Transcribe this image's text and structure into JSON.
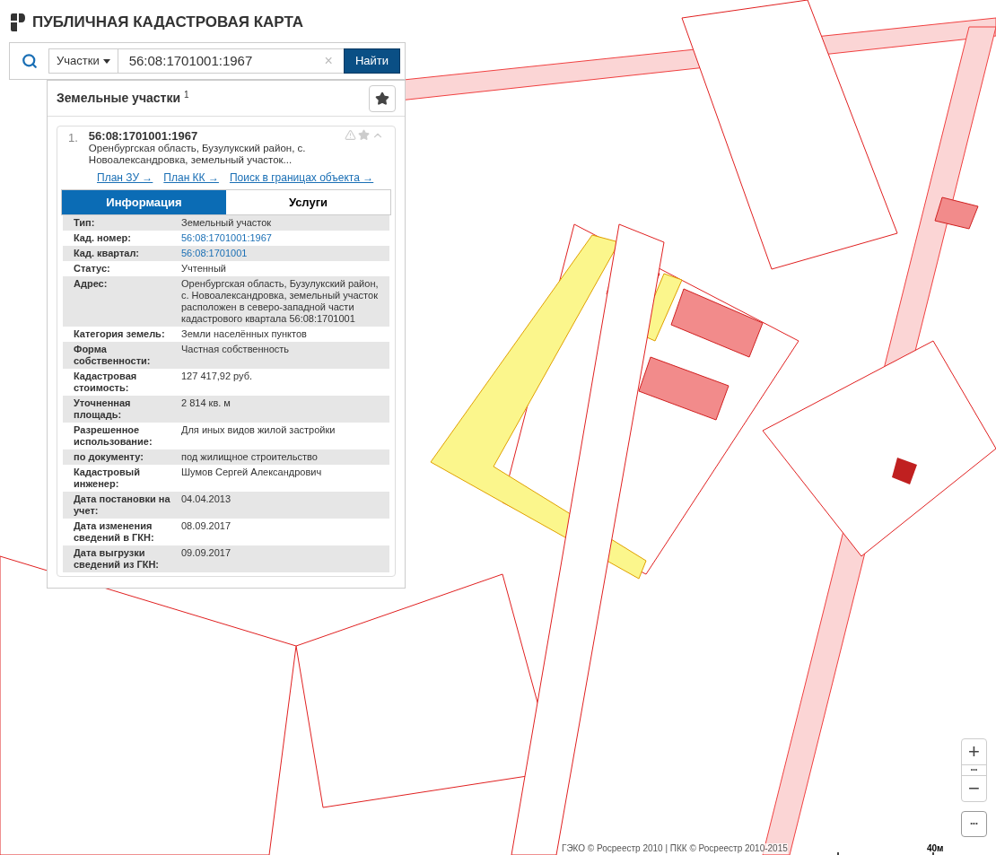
{
  "header": {
    "title": "ПУБЛИЧНАЯ КАДАСТРОВАЯ КАРТА"
  },
  "search": {
    "category": "Участки",
    "value": "56:08:1701001:1967",
    "clear": "×",
    "button": "Найти"
  },
  "panel": {
    "title": "Земельные участки",
    "count": "1",
    "result": {
      "index": "1.",
      "number": "56:08:1701001:1967",
      "address": "Оренбургская область, Бузулукский район, с. Новоалександровка, земельный участок...",
      "expanded": true,
      "links": [
        "План ЗУ →",
        "План КК →",
        "Поиск в границах объекта →"
      ],
      "tabs": [
        {
          "label": "Информация",
          "selected": true
        },
        {
          "label": "Услуги",
          "selected": false
        }
      ],
      "rows": [
        {
          "label": "Тип:",
          "value": "Земельный участок",
          "link": false
        },
        {
          "label": "Кад. номер:",
          "value": "56:08:1701001:1967",
          "link": true
        },
        {
          "label": "Кад. квартал:",
          "value": "56:08:1701001",
          "link": true
        },
        {
          "label": "Статус:",
          "value": "Учтенный",
          "link": false
        },
        {
          "label": "Адрес:",
          "value": "Оренбургская область, Бузулукский район, с. Новоалександровка, земельный участок расположен в северо-западной части кадастрового квартала 56:08:1701001",
          "link": false
        },
        {
          "label": "Категория земель:",
          "value": "Земли населённых пунктов",
          "link": false
        },
        {
          "label": "Форма собственности:",
          "value": "Частная собственность",
          "link": false
        },
        {
          "label": "Кадастровая стоимость:",
          "value": "127 417,92 руб.",
          "link": false
        },
        {
          "label": "Уточненная площадь:",
          "value": "2 814 кв. м",
          "link": false
        },
        {
          "label": "Разрешенное использование:",
          "value": "Для иных видов жилой застройки",
          "link": false
        },
        {
          "label": "по документу:",
          "value": "под жилищное строительство",
          "link": false
        },
        {
          "label": "Кадастровый инженер:",
          "value": "Шумов Сергей Александрович",
          "link": false
        },
        {
          "label": "Дата постановки на учет:",
          "value": "04.04.2013",
          "link": false
        },
        {
          "label": "Дата изменения сведений в ГКН:",
          "value": "08.09.2017",
          "link": false
        },
        {
          "label": "Дата выгрузки сведений из ГКН:",
          "value": "09.09.2017",
          "link": false
        }
      ]
    }
  },
  "controls": {
    "zoom_in": "+",
    "zoom_dots": "•••",
    "zoom_out": "−",
    "more": "•••"
  },
  "attribution": "ГЭКО © Росреестр 2010 | ПКК © Росреестр 2010-2015",
  "scale": "40м"
}
